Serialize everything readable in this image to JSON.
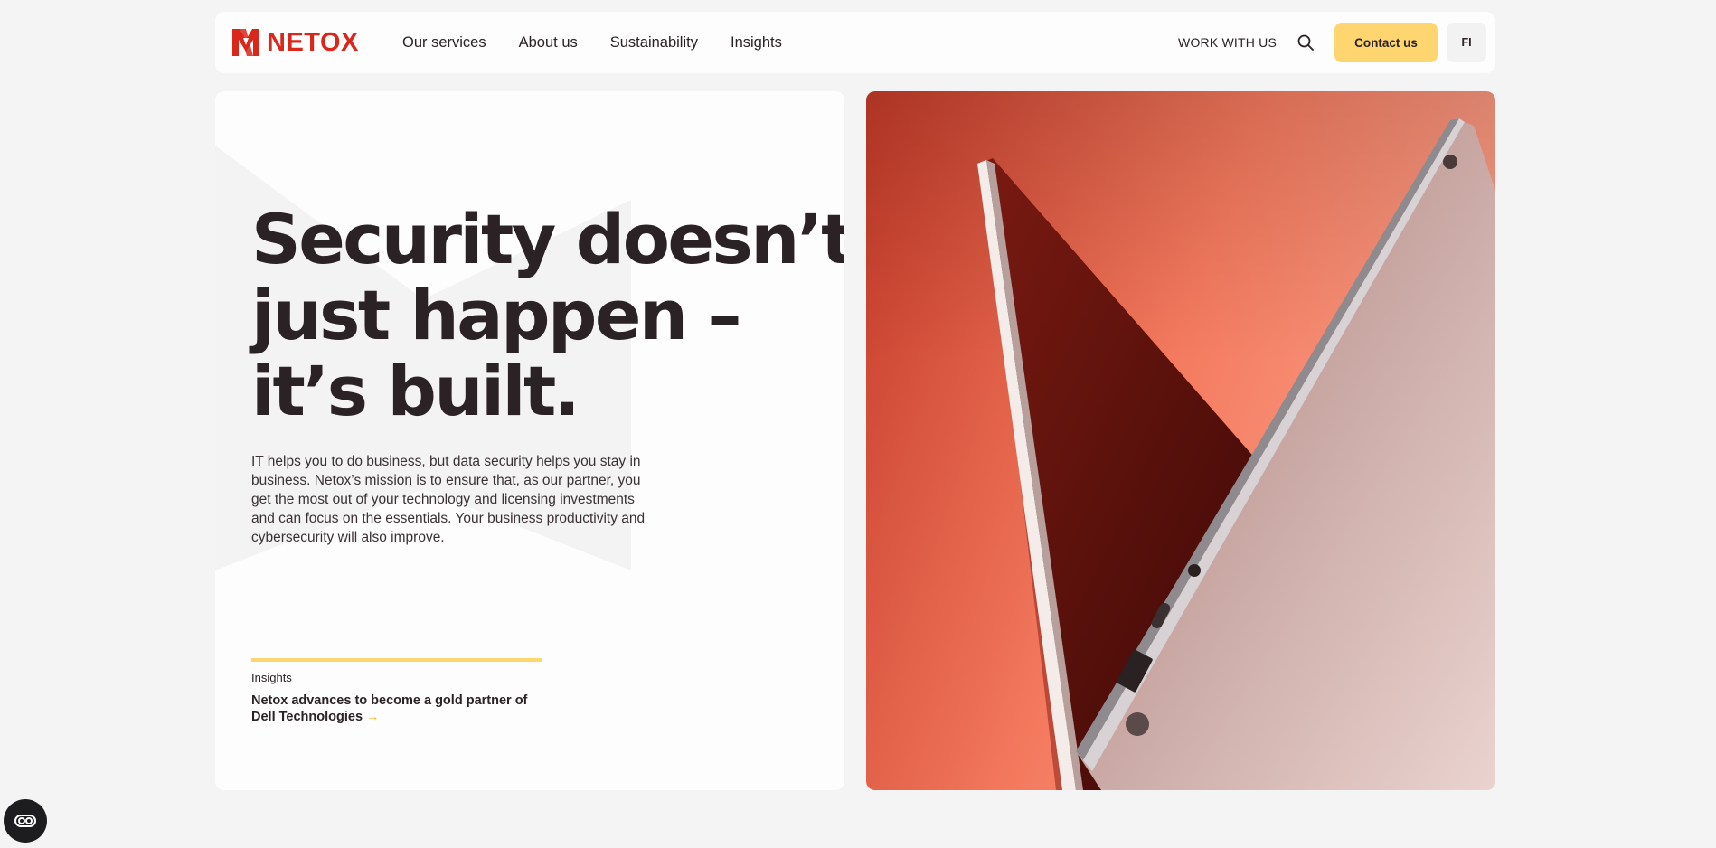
{
  "header": {
    "brand": "NETOX",
    "nav": [
      "Our services",
      "About us",
      "Sustainability",
      "Insights"
    ],
    "work_link": "WORK WITH US",
    "contact_label": "Contact us",
    "lang_label": "FI",
    "icons": {
      "logo": "netox-logo-icon",
      "search": "search-icon"
    }
  },
  "hero": {
    "headline_lines": [
      "Security doesn’t",
      "just happen –",
      "it’s built."
    ],
    "intro": "IT helps you to do business, but data security helps you stay in business. Netox’s mission is to ensure that, as our partner, you get the most out of your technology and licensing investments and can focus on the essentials. Your business productivity and cybersecurity will also improve.",
    "insight": {
      "kicker": "Insights",
      "title": "Netox advances to become a gold partner of Dell Technologies",
      "arrow": "→"
    }
  },
  "colors": {
    "brand_red": "#d9271c",
    "accent_yellow": "#fed56f",
    "text_dark": "#2a2224",
    "page_bg": "#f4f4f4",
    "photo_orange": "#f06a4f"
  },
  "floating": {
    "icon": "cookie-settings-icon"
  }
}
